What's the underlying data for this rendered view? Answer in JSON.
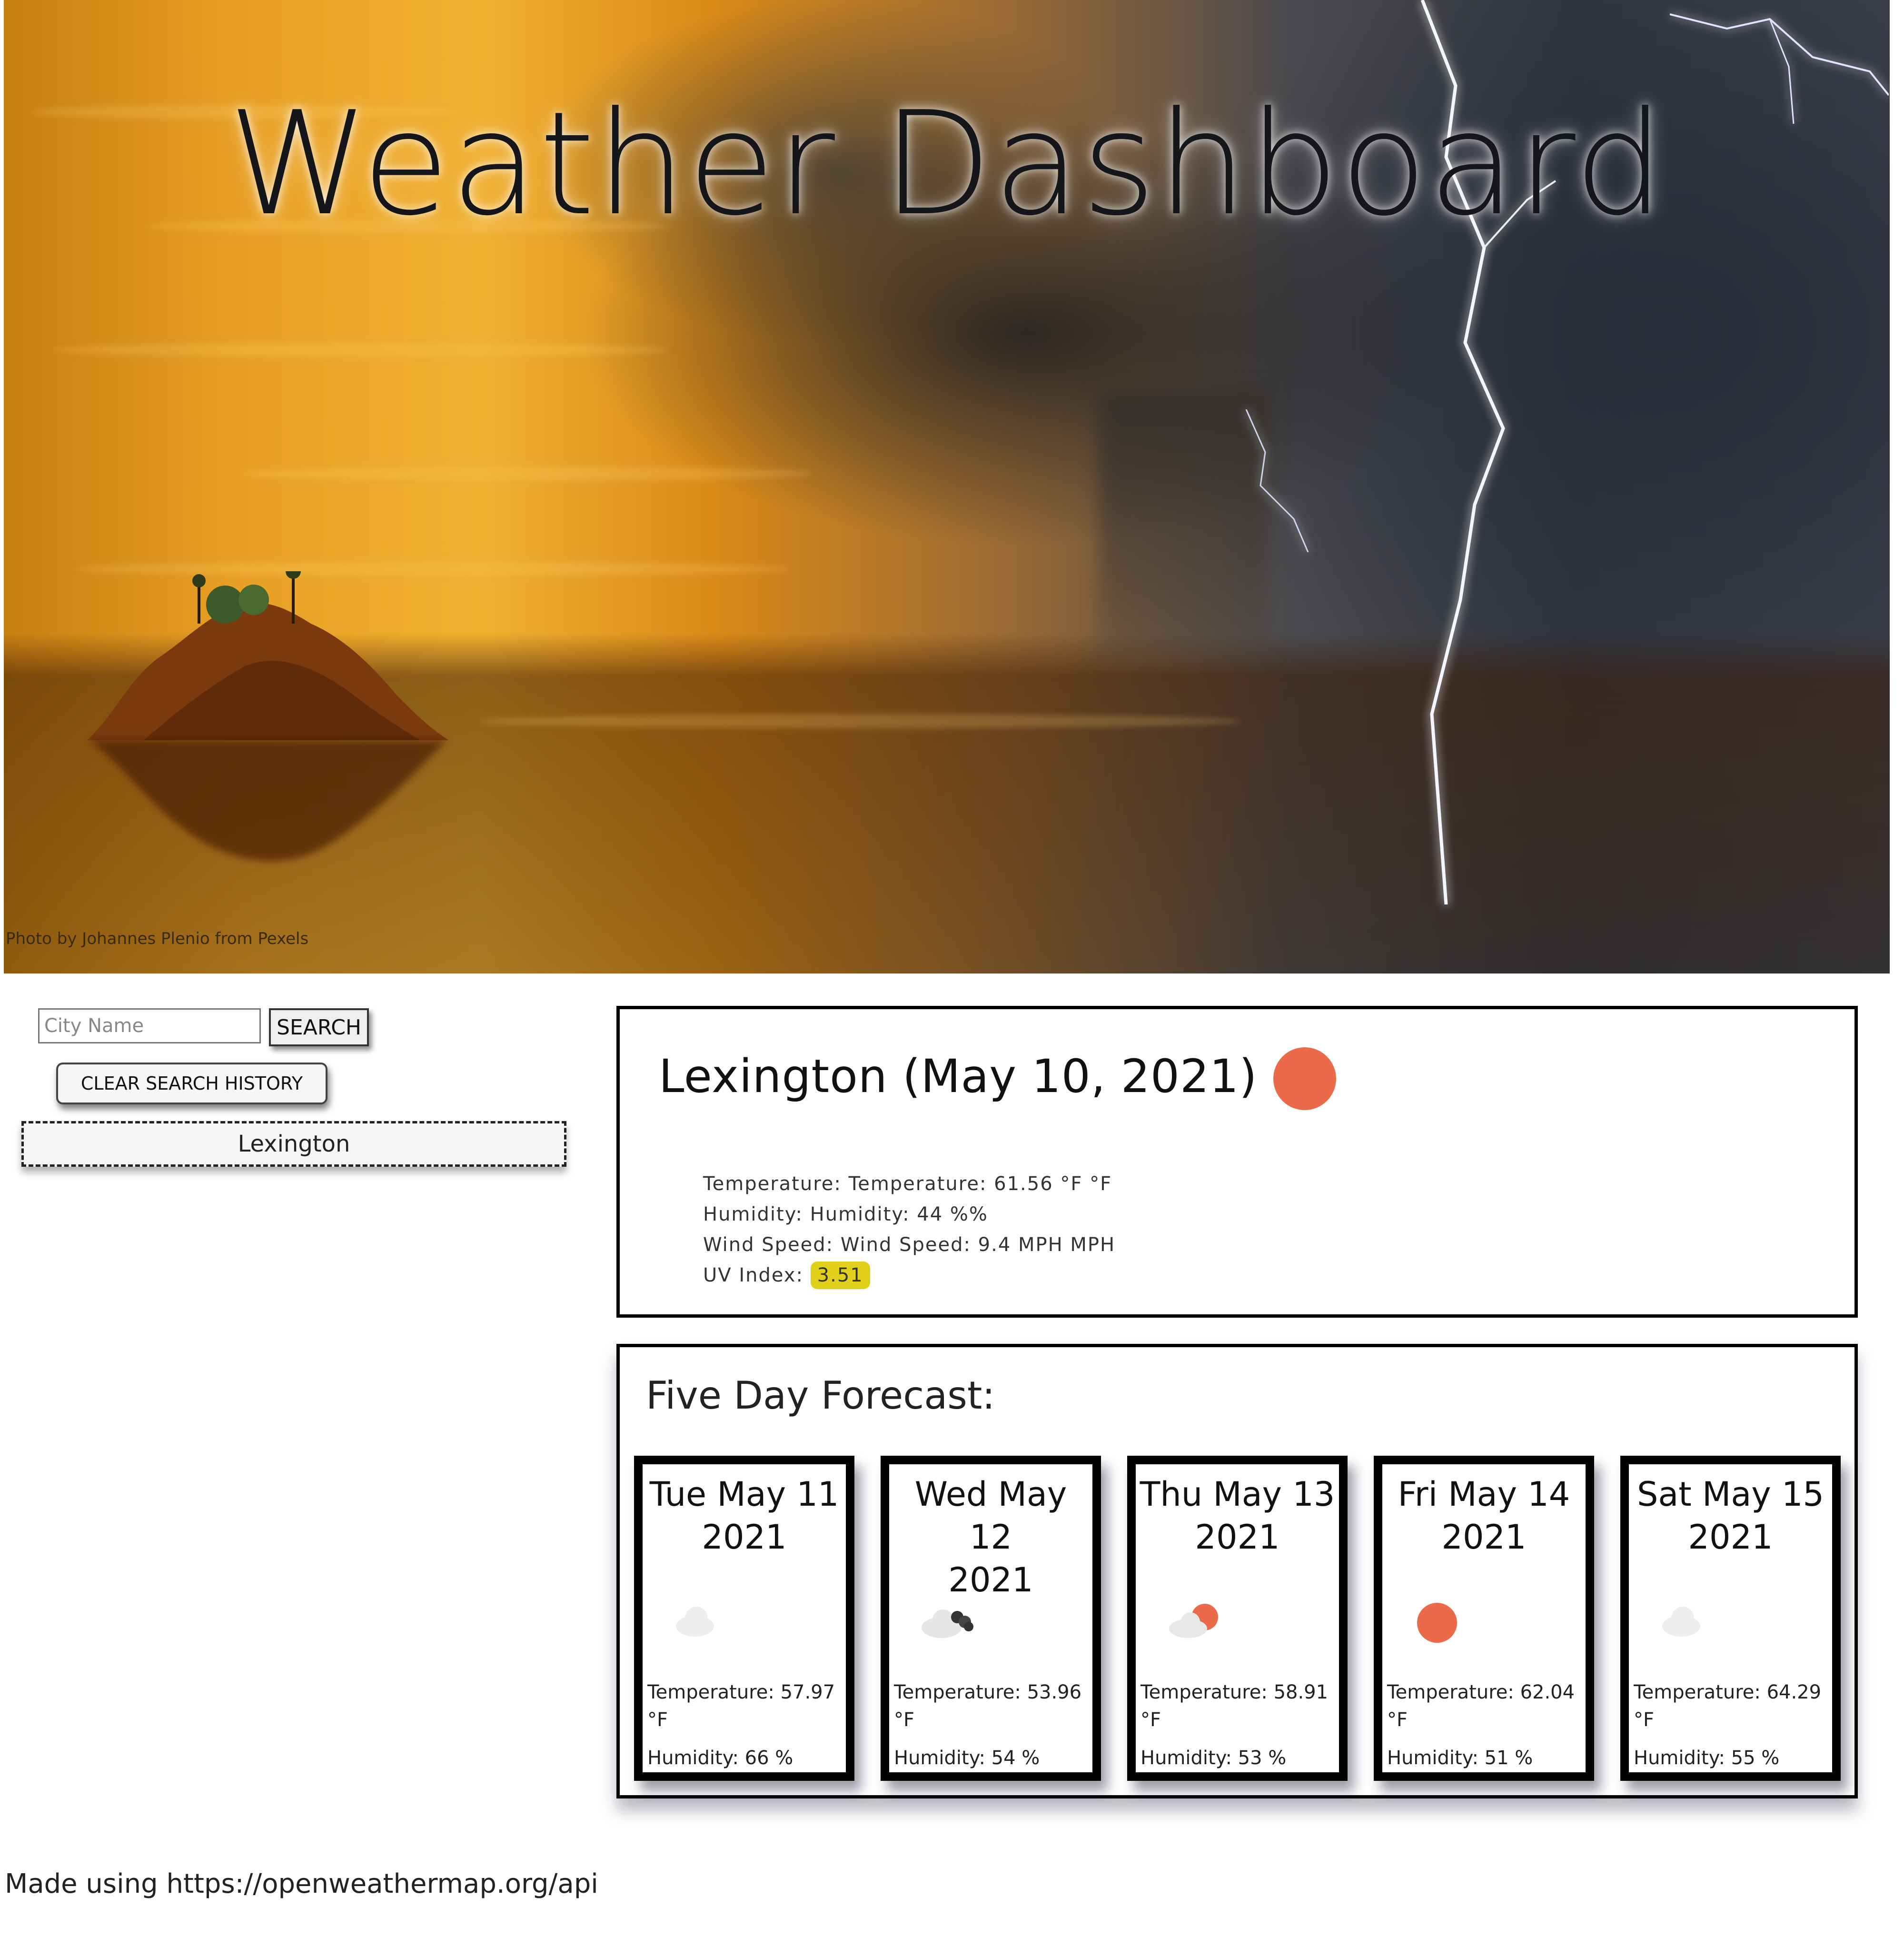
{
  "hero": {
    "title": "Weather Dashboard",
    "photo_credit": "Photo by Johannes Plenio from Pexels"
  },
  "search": {
    "placeholder": "City Name",
    "button_label": "SEARCH",
    "clear_label": "CLEAR SEARCH HISTORY",
    "history": [
      "Lexington"
    ]
  },
  "current": {
    "title": "Lexington (May 10, 2021)",
    "icon": "sun-icon",
    "temperature": "Temperature: Temperature: 61.56 °F °F",
    "humidity": "Humidity: Humidity: 44 %%",
    "wind": "Wind Speed: Wind Speed: 9.4 MPH MPH",
    "uv_label": "UV Index:",
    "uv_value": "3.51",
    "uv_color": "#e1d01a"
  },
  "forecast": {
    "title": "Five Day Forecast:",
    "days": [
      {
        "date_line1": "Tue May 11",
        "date_line2": "2021",
        "icon": "cloud-icon",
        "temperature": "Temperature: 57.97 °F",
        "humidity": "Humidity: 66 %"
      },
      {
        "date_line1": "Wed May 12",
        "date_line2": "2021",
        "icon": "cloud-rain-icon",
        "temperature": "Temperature: 53.96 °F",
        "humidity": "Humidity: 54 %"
      },
      {
        "date_line1": "Thu May 13",
        "date_line2": "2021",
        "icon": "sun-cloud-icon",
        "temperature": "Temperature: 58.91 °F",
        "humidity": "Humidity: 53 %"
      },
      {
        "date_line1": "Fri May 14",
        "date_line2": "2021",
        "icon": "sun-icon",
        "temperature": "Temperature: 62.04 °F",
        "humidity": "Humidity: 51 %"
      },
      {
        "date_line1": "Sat May 15",
        "date_line2": "2021",
        "icon": "cloud-icon",
        "temperature": "Temperature: 64.29 °F",
        "humidity": "Humidity: 55 %"
      }
    ]
  },
  "footer": {
    "note": "Made using https://openweathermap.org/api"
  }
}
